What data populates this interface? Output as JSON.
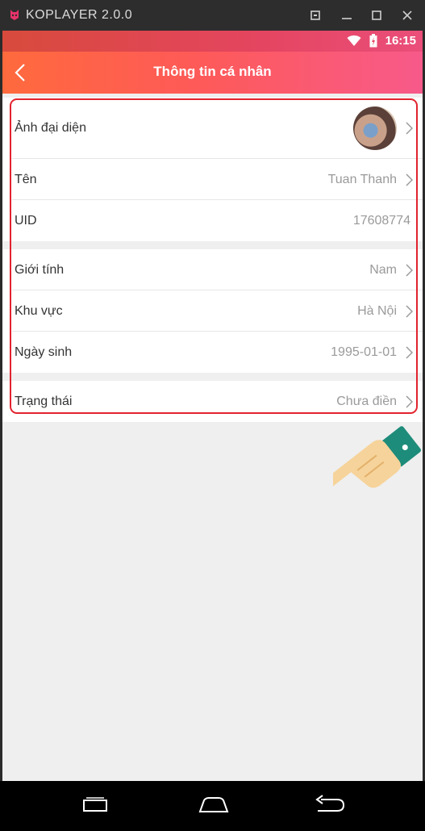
{
  "emulator": {
    "title": "KOPLAYER 2.0.0"
  },
  "status_bar": {
    "time": "16:15"
  },
  "app_bar": {
    "title": "Thông tin cá nhân"
  },
  "profile": {
    "avatar_label": "Ảnh đại diện",
    "name_label": "Tên",
    "name_value": "Tuan Thanh",
    "uid_label": "UID",
    "uid_value": "17608774",
    "gender_label": "Giới tính",
    "gender_value": "Nam",
    "region_label": "Khu vực",
    "region_value": "Hà Nội",
    "birthday_label": "Ngày sinh",
    "birthday_value": "1995-01-01",
    "status_label": "Trạng thái",
    "status_value": "Chưa điền"
  },
  "colors": {
    "accent_start": "#ff6a3d",
    "accent_end": "#f75a8a",
    "highlight": "#e2232e"
  },
  "icons": [
    "back-arrow-icon",
    "chevron-right-icon",
    "wifi-icon",
    "battery-icon",
    "recent-apps-icon",
    "home-icon",
    "back-nav-icon",
    "pointing-hand-icon"
  ]
}
